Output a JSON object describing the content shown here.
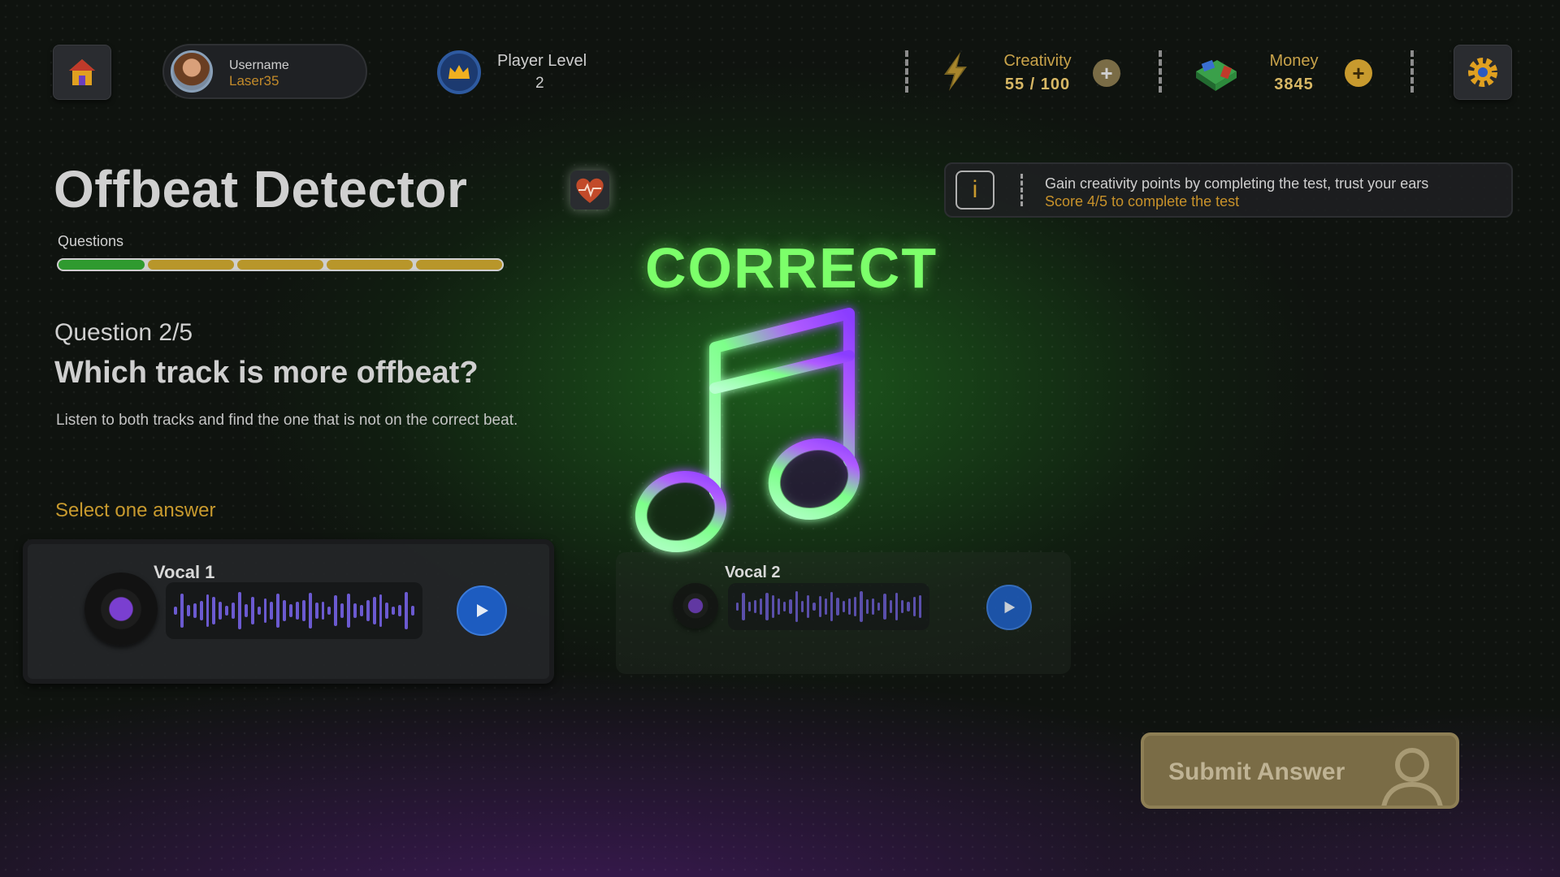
{
  "header": {
    "username_label": "Username",
    "username": "Laser35",
    "level_label": "Player Level",
    "level": "2",
    "creativity_label": "Creativity",
    "creativity_value": "55 / 100",
    "money_label": "Money",
    "money_value": "3845",
    "icons": [
      "home-icon",
      "avatar",
      "crown-icon",
      "lightning-icon",
      "plus-icon",
      "money-stack-icon",
      "gear-icon"
    ]
  },
  "game": {
    "title": "Offbeat Detector",
    "questions_label": "Questions",
    "progress": [
      "correct",
      "pending",
      "pending",
      "pending",
      "pending"
    ],
    "question_count": "Question 2/5",
    "question": "Which track is more offbeat?",
    "description": "Listen to both tracks and find the one that is not on the correct beat.",
    "select_label": "Select one answer",
    "feedback": "CORRECT"
  },
  "info": {
    "icon_text": "i",
    "line1": "Gain creativity points by completing the test, trust your ears",
    "line2": "Score 4/5 to complete the test"
  },
  "tracks": [
    {
      "title": "Vocal 1",
      "selected": true
    },
    {
      "title": "Vocal 2",
      "selected": false
    }
  ],
  "submit": {
    "label": "Submit Answer"
  },
  "colors": {
    "accent_gold": "#c89a2e",
    "correct_green": "#7cff6a",
    "progress_done": "#2f9a2f",
    "progress_pending": "#b8962a",
    "play_blue": "#1d5cc0"
  }
}
